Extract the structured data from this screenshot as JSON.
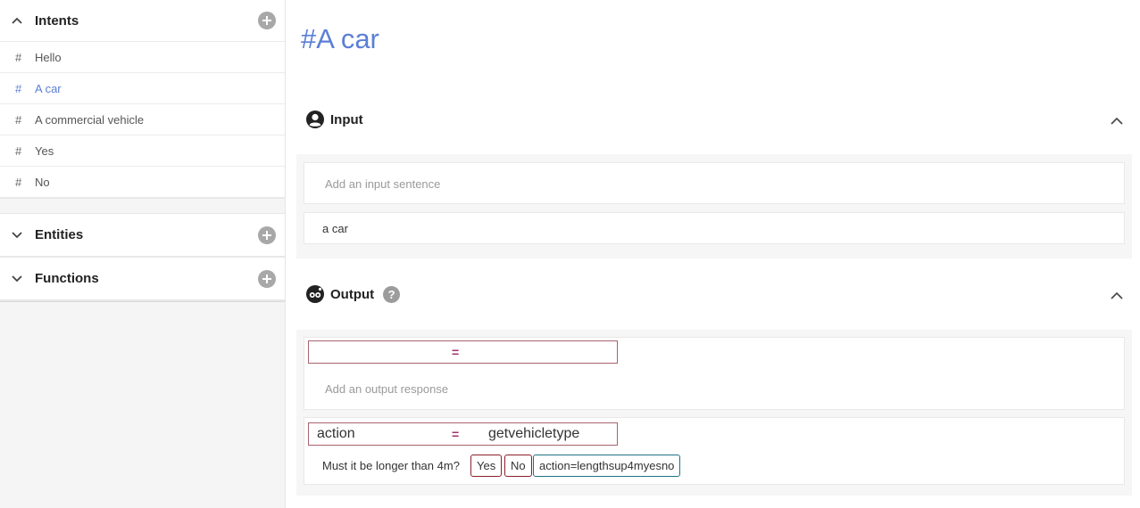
{
  "sidebar": {
    "intents": {
      "title": "Intents",
      "items": [
        {
          "hash": "#",
          "label": "Hello"
        },
        {
          "hash": "#",
          "label": "A car"
        },
        {
          "hash": "#",
          "label": "A commercial vehicle"
        },
        {
          "hash": "#",
          "label": "Yes"
        },
        {
          "hash": "#",
          "label": "No"
        }
      ]
    },
    "entities": {
      "title": "Entities"
    },
    "functions": {
      "title": "Functions"
    }
  },
  "main": {
    "title": "#A car",
    "input": {
      "title": "Input",
      "placeholder": "Add an input sentence",
      "sentences": [
        "a car"
      ]
    },
    "output": {
      "title": "Output",
      "help": "?",
      "new_kv": {
        "key": "",
        "eq": "=",
        "value": ""
      },
      "placeholder": "Add an output response",
      "response": {
        "key": "action",
        "eq": "=",
        "value": "getvehicletype",
        "text": "Must it be longer than 4m?",
        "buttons": [
          "Yes",
          "No"
        ],
        "action_chip": "action=lengthsup4myesno"
      }
    }
  },
  "colors": {
    "accent": "#5b7fd6",
    "kv_border": "#a6636c",
    "chip_red": "#8b1f2a",
    "chip_teal": "#1f7385"
  }
}
